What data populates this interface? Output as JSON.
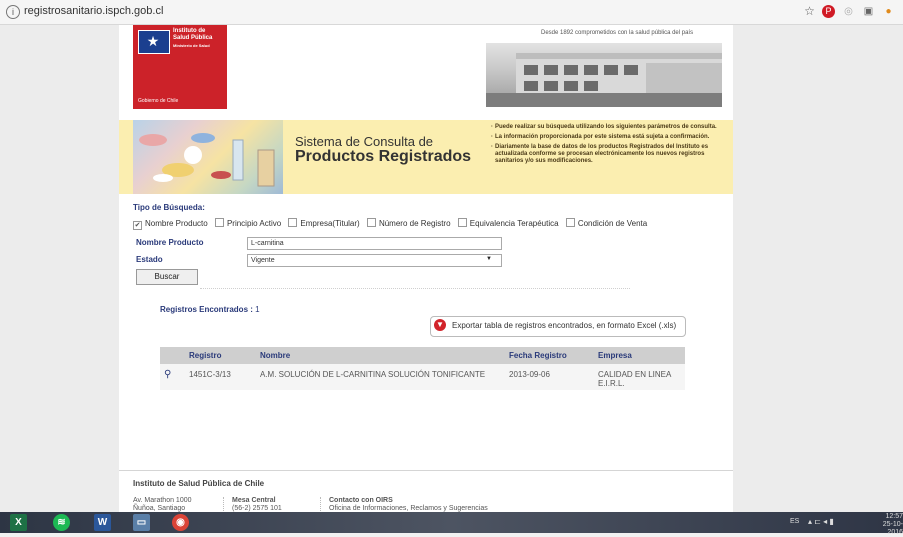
{
  "browser": {
    "url": "registrosanitario.ispch.gob.cl",
    "icons": [
      "star-icon",
      "pinterest-icon",
      "extension-icon",
      "cast-icon",
      "extension-icon"
    ]
  },
  "header": {
    "logo_lines": [
      "Instituto de",
      "Salud Pública",
      "Ministerio de Salud"
    ],
    "logo_gov": "Gobierno de Chile",
    "tagline": "Desde 1892 comprometidos con la salud pública del país"
  },
  "banner": {
    "title_line1": "Sistema de Consulta de",
    "title_line2": "Productos Registrados",
    "notes": [
      "Puede realizar su búsqueda utilizando los siguientes parámetros de consulta.",
      "La información proporcionada por este sistema está sujeta a confirmación.",
      "Diariamente la base de datos de los productos Registrados del Instituto es actualizada conforme se procesan electrónicamente los nuevos registros sanitarios y/o sus modificaciones."
    ]
  },
  "search": {
    "tipo_label": "Tipo de Búsqueda:",
    "options": [
      {
        "label": "Nombre Producto",
        "checked": true
      },
      {
        "label": "Principio Activo",
        "checked": false
      },
      {
        "label": "Empresa(Titular)",
        "checked": false
      },
      {
        "label": "Número de Registro",
        "checked": false
      },
      {
        "label": "Equivalencia Terapéutica",
        "checked": false
      },
      {
        "label": "Condición de Venta",
        "checked": false
      }
    ],
    "nombre_label": "Nombre Producto",
    "nombre_value": "L-carnitina",
    "estado_label": "Estado",
    "estado_value": "Vigente",
    "buscar_label": "Buscar"
  },
  "results": {
    "count_label": "Registros Encontrados :",
    "count": "1",
    "export_label": "Exportar tabla de registros encontrados, en formato Excel (.xls)",
    "columns": [
      "Registro",
      "Nombre",
      "Fecha Registro",
      "Empresa"
    ],
    "rows": [
      {
        "registro": "1451C-3/13",
        "nombre": "A.M. SOLUCIÓN DE L-CARNITINA SOLUCIÓN TONIFICANTE",
        "fecha": "2013-09-06",
        "empresa_line1": "CALIDAD EN LINEA",
        "empresa_line2": "E.I.R.L."
      }
    ]
  },
  "footer": {
    "title": "Instituto de Salud Pública de Chile",
    "address_line1": "Av. Marathon 1000",
    "address_line2": "Ñuñoa, Santiago",
    "mesa_title": "Mesa Central",
    "mesa_phone": "(56-2) 2575 101",
    "oirs_title": "Contacto con OIRS",
    "oirs_desc": "Oficina de Informaciones, Reclamos y Sugerencias"
  },
  "taskbar": {
    "lang": "ES",
    "time": "12:57",
    "date": "25-10-2016"
  }
}
